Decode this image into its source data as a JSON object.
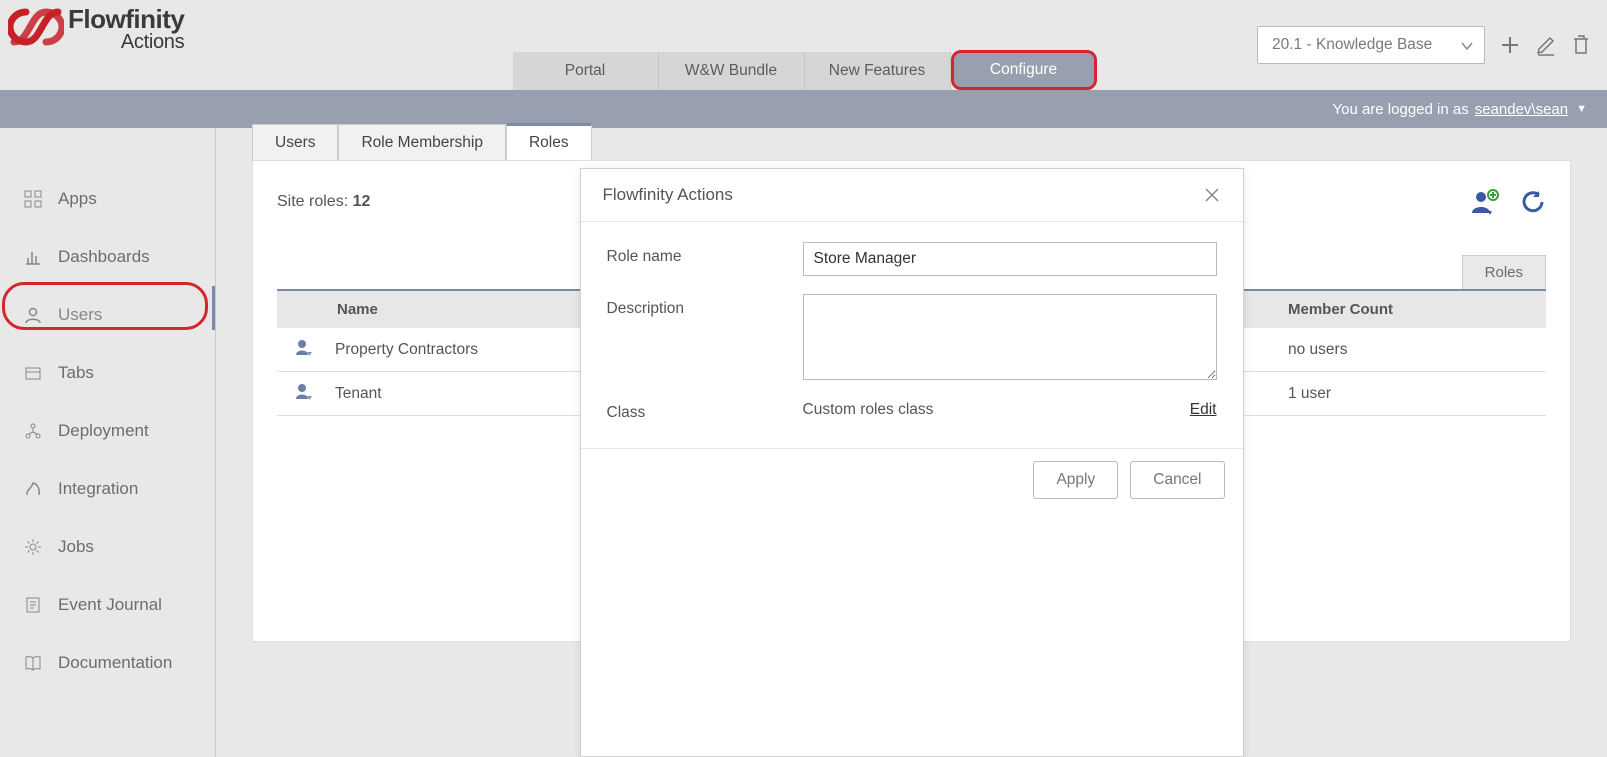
{
  "logo": {
    "title": "Flowfinity",
    "sub": "Actions"
  },
  "header": {
    "version": "20.1 - Knowledge Base",
    "tabs": [
      "Portal",
      "W&W Bundle",
      "New Features",
      "Configure"
    ],
    "active_tab": "Configure"
  },
  "loginbar": {
    "prefix": "You are logged in as",
    "user": "seandev\\sean"
  },
  "sidebar": {
    "items": [
      {
        "id": "apps",
        "label": "Apps"
      },
      {
        "id": "dashboards",
        "label": "Dashboards"
      },
      {
        "id": "users",
        "label": "Users"
      },
      {
        "id": "tabs",
        "label": "Tabs"
      },
      {
        "id": "deployment",
        "label": "Deployment"
      },
      {
        "id": "integration",
        "label": "Integration"
      },
      {
        "id": "jobs",
        "label": "Jobs"
      },
      {
        "id": "event-journal",
        "label": "Event Journal"
      },
      {
        "id": "documentation",
        "label": "Documentation"
      }
    ],
    "active": "users"
  },
  "panel": {
    "tabs": [
      "Users",
      "Role Membership",
      "Roles"
    ],
    "active_tab": "Roles",
    "site_roles_label": "Site roles:",
    "site_roles_count": "12",
    "filter_tab": "Roles",
    "columns": {
      "name": "Name",
      "count": "Member Count"
    },
    "rows": [
      {
        "name": "Property Contractors",
        "count": "no users"
      },
      {
        "name": "Tenant",
        "count": "1 user"
      }
    ],
    "add_role_btn": "Add Role",
    "refresh_btn": "Refresh"
  },
  "modal": {
    "title": "Flowfinity Actions",
    "fields": {
      "role_name_label": "Role name",
      "role_name_value": "Store Manager",
      "description_label": "Description",
      "description_value": "",
      "class_label": "Class",
      "class_value": "Custom roles class",
      "edit": "Edit"
    },
    "apply": "Apply",
    "cancel": "Cancel"
  }
}
